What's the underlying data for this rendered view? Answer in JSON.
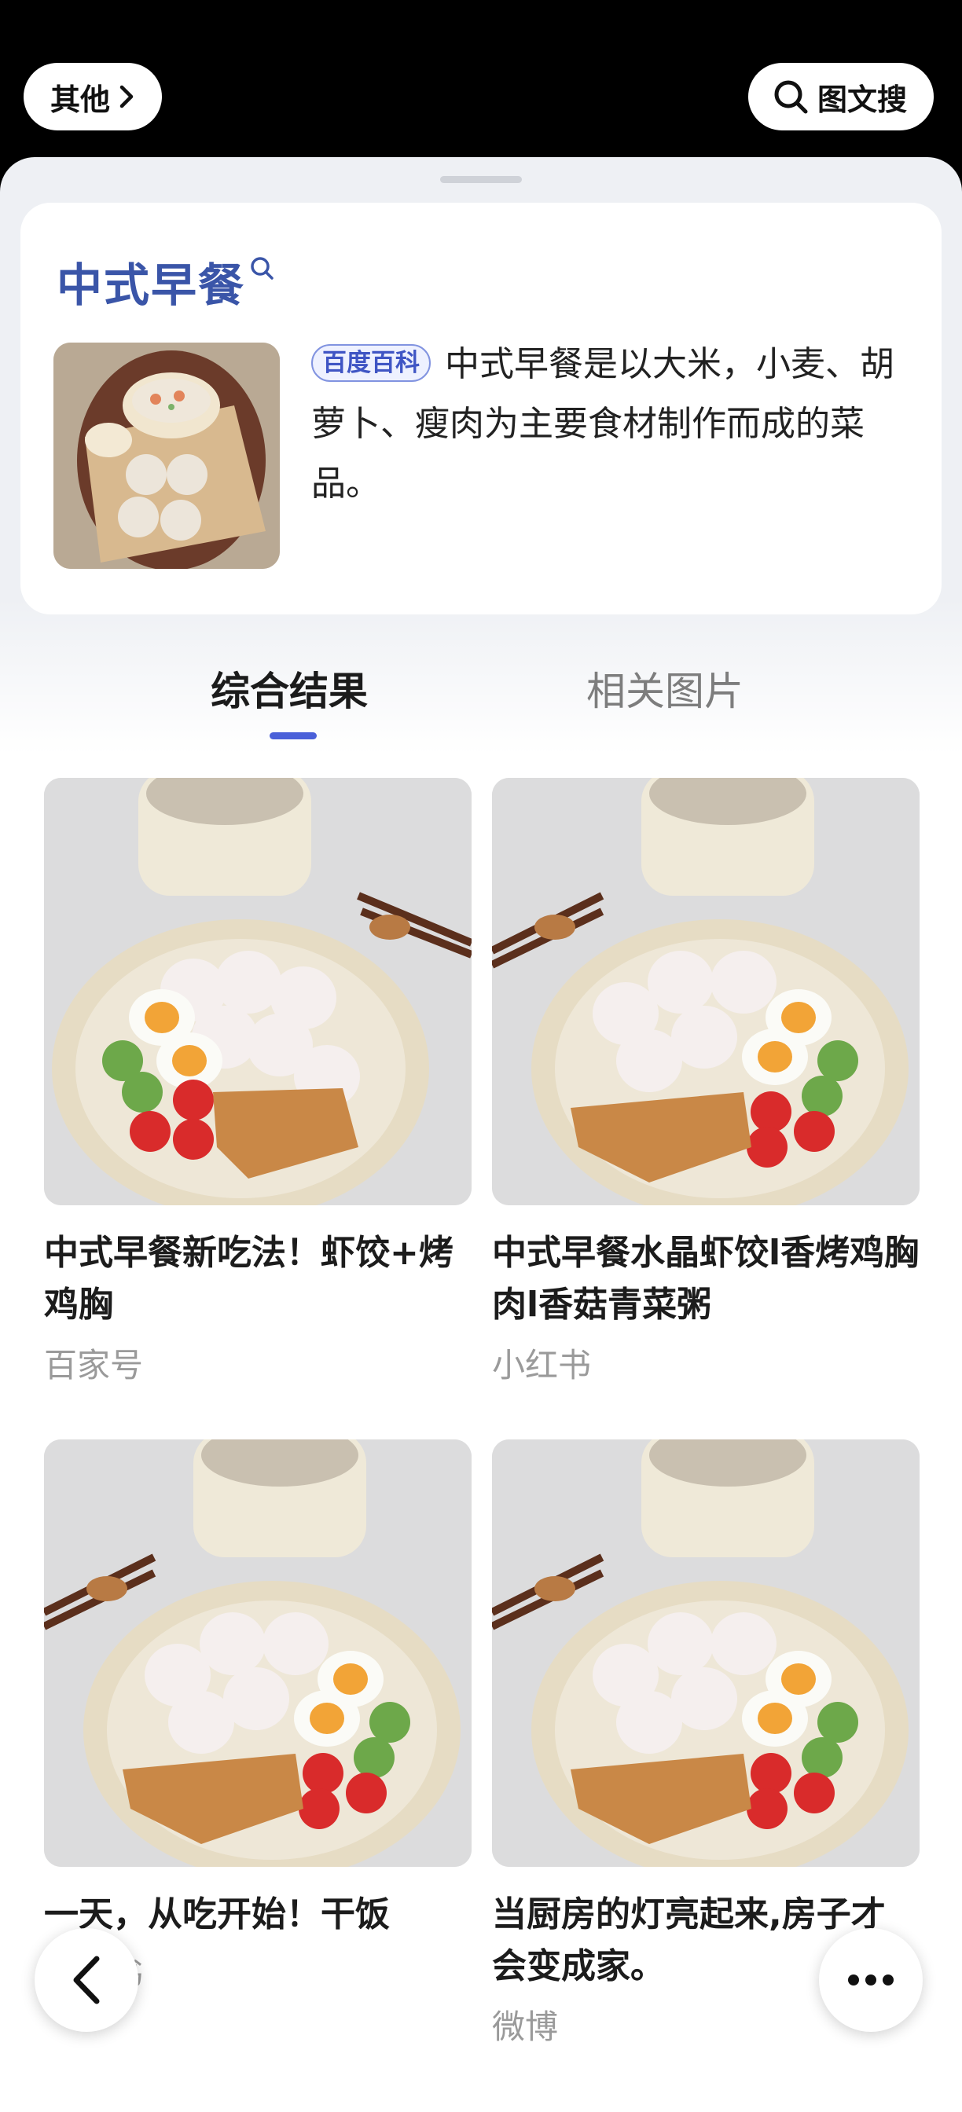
{
  "topbar": {
    "other_label": "其他",
    "search_label": "图文搜"
  },
  "card": {
    "title": "中式早餐",
    "badge": "百度百科",
    "description": "中式早餐是以大米，小麦、胡萝卜、瘦肉为主要食材制作而成的菜品。"
  },
  "tabs": [
    {
      "label": "综合结果",
      "active": true
    },
    {
      "label": "相关图片",
      "active": false
    }
  ],
  "results": [
    {
      "title": "中式早餐新吃法！虾饺+烤鸡胸",
      "source": "百家号"
    },
    {
      "title": "中式早餐水晶虾饺l香烤鸡胸肉l香菇青菜粥",
      "source": "小红书"
    },
    {
      "title": "一天，从吃开始！干饭",
      "source": "小红书"
    },
    {
      "title": "当厨房的灯亮起来,房子才会变成家。",
      "source": "微博"
    }
  ],
  "colors": {
    "accent": "#4a60d9",
    "title_blue": "#3a55a8"
  },
  "icons": [
    "chevron-right-icon",
    "search-icon",
    "back-arrow-icon",
    "more-dots-icon"
  ]
}
